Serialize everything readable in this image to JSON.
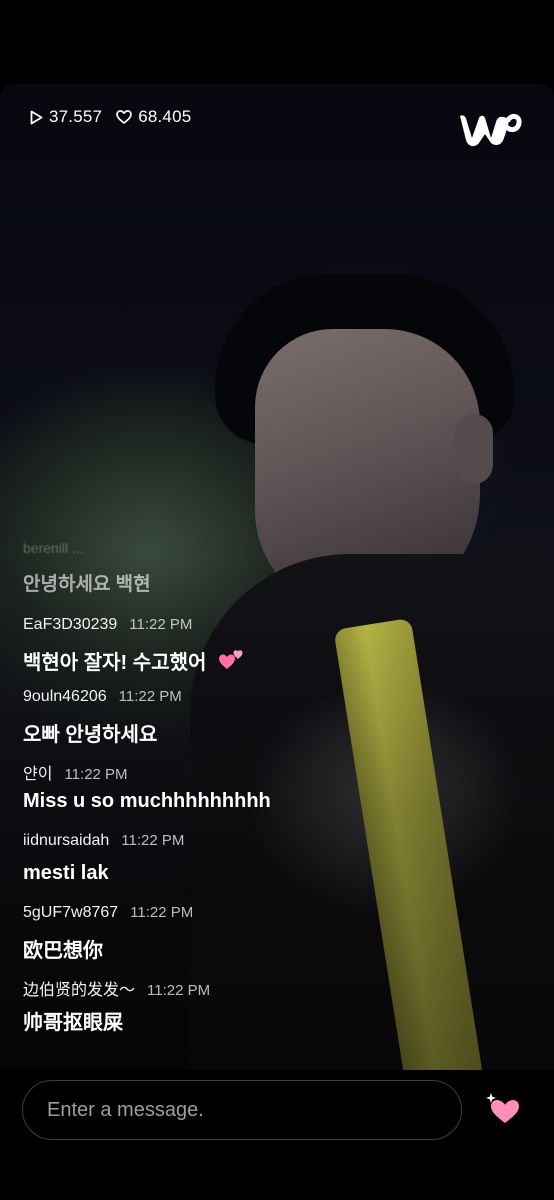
{
  "stats": {
    "plays": "37.557",
    "likes": "68.405"
  },
  "brand": {
    "logo_icon": "weverse-logo-icon"
  },
  "chat": {
    "faded_line": "berenill ...",
    "previous_message": "안녕하세요 백현",
    "messages": [
      {
        "user": "EaF3D30239",
        "time": "11:22 PM",
        "text": "백현아 잘자! 수고했어",
        "emoji": "two-hearts-icon"
      },
      {
        "user": "9ouln46206",
        "time": "11:22 PM",
        "text": "오빠 안녕하세요"
      },
      {
        "user": "얀이",
        "time": "11:22 PM",
        "text": "Miss u so  muchhhhhhhhh"
      },
      {
        "user": "iidnursaidah",
        "time": "11:22 PM",
        "text": "mesti lak"
      },
      {
        "user": "5gUF7w8767",
        "time": "11:22 PM",
        "text": "欧巴想你"
      },
      {
        "user": "边伯贤的发发～",
        "time": "11:22 PM",
        "text": "帅哥抠眼屎"
      }
    ]
  },
  "input": {
    "placeholder": "Enter a message.",
    "value": ""
  },
  "like_button": {
    "icon": "sparkle-heart-icon",
    "color": "#ff8fb8"
  }
}
